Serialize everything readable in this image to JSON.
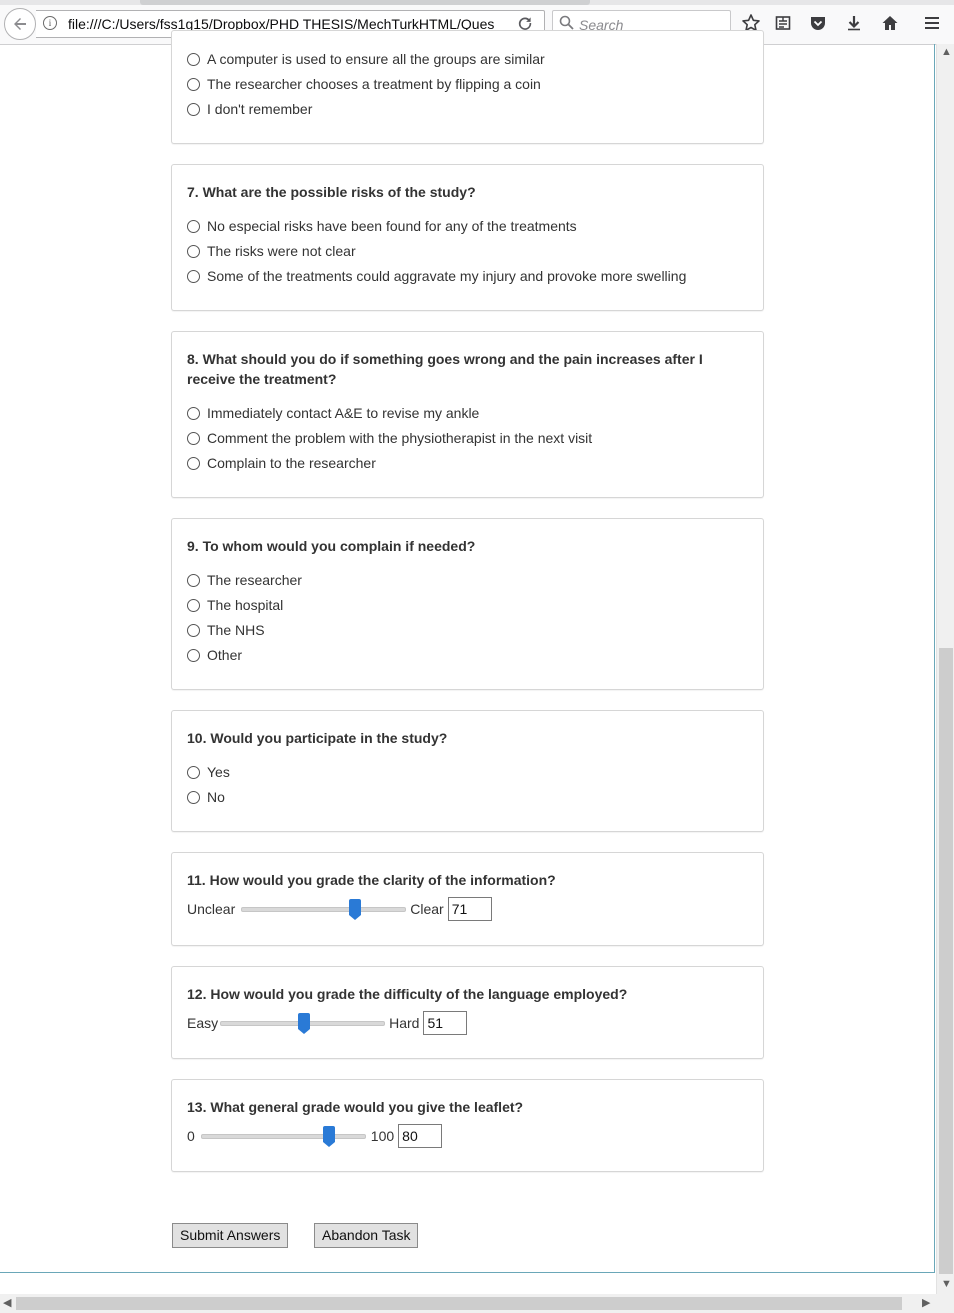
{
  "browser": {
    "url": "file:///C:/Users/fss1g15/Dropbox/PHD THESIS/MechTurkHTML/Ques",
    "search_placeholder": "Search",
    "icons": [
      "back-icon",
      "info-icon",
      "reload-icon",
      "search-icon",
      "bookmark-star-icon",
      "reader-list-icon",
      "pocket-icon",
      "download-icon",
      "home-icon",
      "menu-icon"
    ]
  },
  "q6": {
    "options": [
      "A computer is used to ensure all the groups are similar",
      "The researcher chooses a treatment by flipping a coin",
      "I don't remember"
    ]
  },
  "q7": {
    "title": "7. What are the possible risks of the study?",
    "options": [
      "No especial risks have been found for any of the treatments",
      "The risks were not clear",
      "Some of the treatments could aggravate my injury and provoke more swelling"
    ]
  },
  "q8": {
    "title": "8. What should you do if something goes wrong and the pain increases after I receive the treatment?",
    "options": [
      "Immediately contact A&E to revise my ankle",
      "Comment the problem with the physiotherapist in the next visit",
      "Complain to the researcher"
    ]
  },
  "q9": {
    "title": "9. To whom would you complain if needed?",
    "options": [
      "The researcher",
      "The hospital",
      "The NHS",
      "Other"
    ]
  },
  "q10": {
    "title": "10. Would you participate in the study?",
    "options": [
      "Yes",
      "No"
    ]
  },
  "q11": {
    "title": "11. How would you grade the clarity of the information?",
    "min_label": "Unclear",
    "max_label": "Clear",
    "value": "71",
    "level": 0.71
  },
  "q12": {
    "title": "12. How would you grade the difficulty of the language employed?",
    "min_label": "Easy",
    "max_label": "Hard",
    "value": "51",
    "level": 0.51
  },
  "q13": {
    "title": "13. What general grade would you give the leaflet?",
    "min_label": "0",
    "max_label": "100",
    "value": "80",
    "level": 0.8
  },
  "actions": {
    "submit": "Submit Answers",
    "abandon": "Abandon Task"
  }
}
